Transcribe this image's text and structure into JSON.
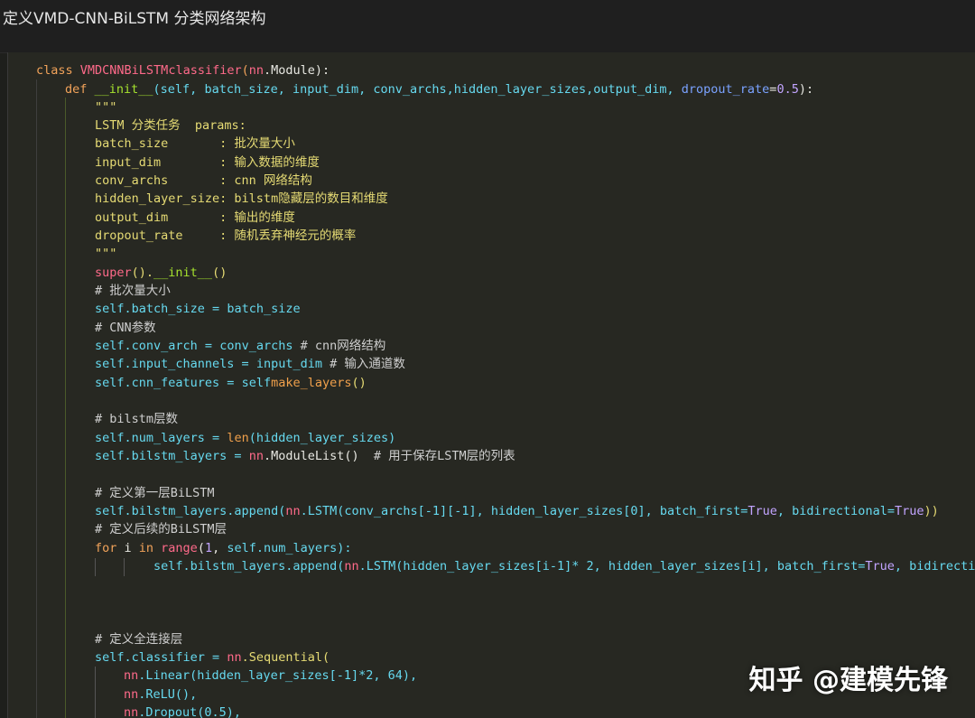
{
  "title": "定义VMD-CNN-BiLSTM 分类网络架构",
  "watermark": "知乎 @建模先锋",
  "code": {
    "l1": {
      "a": "class ",
      "b": "VMDCNNBiLSTMclassifier",
      "c": "(",
      "d": "nn",
      "e": ".Module",
      ")": "):"
    },
    "l2": {
      "a": "def ",
      "b": "__init__",
      "c": "(self, batch_size, input_dim, conv_archs,hidden_layer_sizes,output_dim, ",
      "d": "dropout_rate",
      "e": "=",
      "f": "0.5",
      "g": "):"
    },
    "l3": "\"\"\"",
    "l4": "LSTM 分类任务  params:",
    "l5": "batch_size       : 批次量大小",
    "l6": "input_dim        : 输入数据的维度",
    "l7": "conv_archs       : cnn 网络结构",
    "l8": "hidden_layer_size: bilstm隐藏层的数目和维度",
    "l9": "output_dim       : 输出的维度",
    "l10": "dropout_rate     : 随机丢弃神经元的概率",
    "l11": "\"\"\"",
    "l12": {
      "a": "super",
      "b": "().",
      "c": "__init__",
      "d": "()"
    },
    "l13": "# 批次量大小",
    "l14": {
      "a": "self",
      "b": ".batch_size = ",
      "c": "batch_size"
    },
    "l15": "# CNN参数",
    "l16": {
      "a": "self",
      "b": ".conv_arch = ",
      "c": "conv_archs",
      "d": " # cnn网络结构"
    },
    "l17": {
      "a": "self",
      "b": ".input_channels = ",
      "c": "input_dim",
      "d": " # 输入通道数"
    },
    "l18": {
      "a": "self",
      "b": ".cnn_features = ",
      "c": "self",
      ".": ".",
      "d": "make_layers",
      "e": "()"
    },
    "l19": "# bilstm层数",
    "l20": {
      "a": "self",
      "b": ".num_layers = ",
      "c": "len",
      "d": "(hidden_layer_sizes)"
    },
    "l21": {
      "a": "self",
      "b": ".bilstm_layers = ",
      "c": "nn",
      "d": ".ModuleList()",
      "e": "  # 用于保存LSTM层的列表"
    },
    "l22": "# 定义第一层BiLSTM",
    "l23": {
      "a": "self",
      "b": ".bilstm_layers.append(",
      "c": "nn",
      "d": ".LSTM(conv_archs[-1][-1], hidden_layer_sizes[0], batch_first=",
      "e": "True",
      ",": ", bidirectional=",
      "f": "True",
      "g": "))"
    },
    "l24": "# 定义后续的BiLSTM层",
    "l25": {
      "a": "for ",
      "b": "i ",
      "c": "in ",
      "d": "range",
      "e": "(",
      "f": "1",
      ",": ", ",
      "g": "self",
      "h": ".num_layers):"
    },
    "l26": {
      "a": "self",
      "b": ".bilstm_layers.append(",
      "c": "nn",
      "d": ".LSTM(hidden_layer_sizes[i-1]* 2, hidden_layer_sizes[i], batch_first=",
      "e": "True",
      "f": ", bidirectio"
    },
    "l27": "# 定义全连接层",
    "l28": {
      "a": "self",
      "b": ".classifier = ",
      "c": "nn",
      "d": ".Sequential("
    },
    "l29": {
      "a": "nn",
      "b": ".Linear(hidden_layer_sizes[-1]*2, 64),"
    },
    "l30": {
      "a": "nn",
      "b": ".ReLU(),"
    },
    "l31": {
      "a": "nn",
      "b": ".Dropout(0.5),"
    }
  }
}
